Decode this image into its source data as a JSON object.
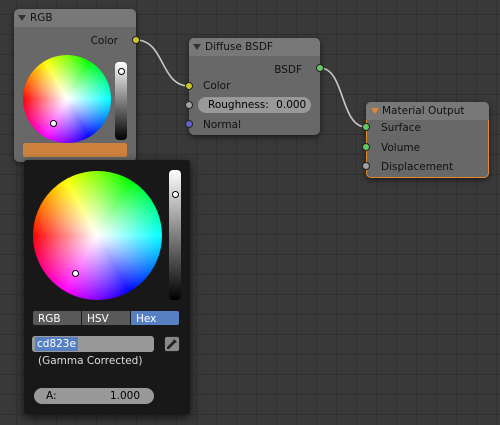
{
  "rgb_node": {
    "title": "RGB",
    "output_label": "Color",
    "swatch_color": "#cd823e"
  },
  "diffuse_node": {
    "title": "Diffuse BSDF",
    "output_label": "BSDF",
    "inputs": {
      "color": "Color",
      "normal": "Normal"
    },
    "roughness_label": "Roughness:",
    "roughness_value": "0.000"
  },
  "material_output_node": {
    "title": "Material Output",
    "inputs": {
      "surface": "Surface",
      "volume": "Volume",
      "displacement": "Displacement"
    },
    "accent_color": "#e08a2e"
  },
  "color_picker": {
    "tabs": [
      "RGB",
      "HSV",
      "Hex"
    ],
    "active_tab": "Hex",
    "hex_value": "cd823e",
    "note": "(Gamma Corrected)",
    "alpha_label": "A:",
    "alpha_value": "1.000",
    "eyedropper_icon": "eyedropper-icon"
  },
  "colors": {
    "socket_color": "#c7c729",
    "socket_shader": "#63c763",
    "socket_float": "#a1a1a1",
    "socket_vector": "#6363c7",
    "tab_active": "#5680c2"
  }
}
